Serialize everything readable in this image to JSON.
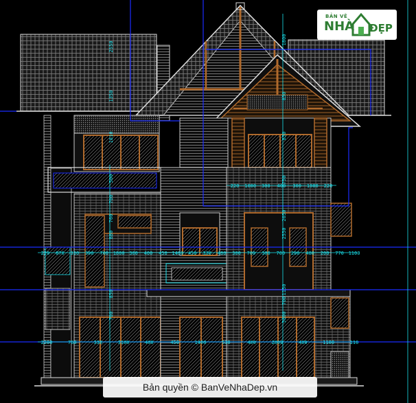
{
  "logo": {
    "top": "BẢN VẼ",
    "left_word": "NHÀ",
    "right_word": "ĐẸP"
  },
  "watermark": "Bản quyền © BanVeNhaDep.vn",
  "dims": {
    "row_top": [
      "220",
      "1080",
      "300",
      "400",
      "300",
      "1080",
      "220"
    ],
    "row_mid": [
      "220",
      "870",
      "330",
      "300",
      "700",
      "1800",
      "300",
      "400",
      "450",
      "1400",
      "450",
      "330",
      "480",
      "300",
      "700",
      "300",
      "700",
      "200",
      "480",
      "200",
      "770",
      "1100"
    ],
    "row_bot": [
      "2200",
      "760",
      "330",
      "3100",
      "400",
      "450",
      "1400",
      "530",
      "400",
      "2800",
      "400",
      "1100",
      "110"
    ],
    "vert": [
      "2550",
      "1350",
      "1810",
      "500",
      "700",
      "760",
      "880",
      "850",
      "700",
      "1800",
      "850",
      "850",
      "750",
      "2050",
      "2550",
      "1150",
      "700",
      "5800"
    ]
  },
  "colors": {
    "cad_blue": "#1a2cff",
    "dim_cyan": "#19e3ee",
    "wood": "#b06a2c",
    "tile": "#9a9a9a",
    "brick": "#7f7f7f"
  }
}
